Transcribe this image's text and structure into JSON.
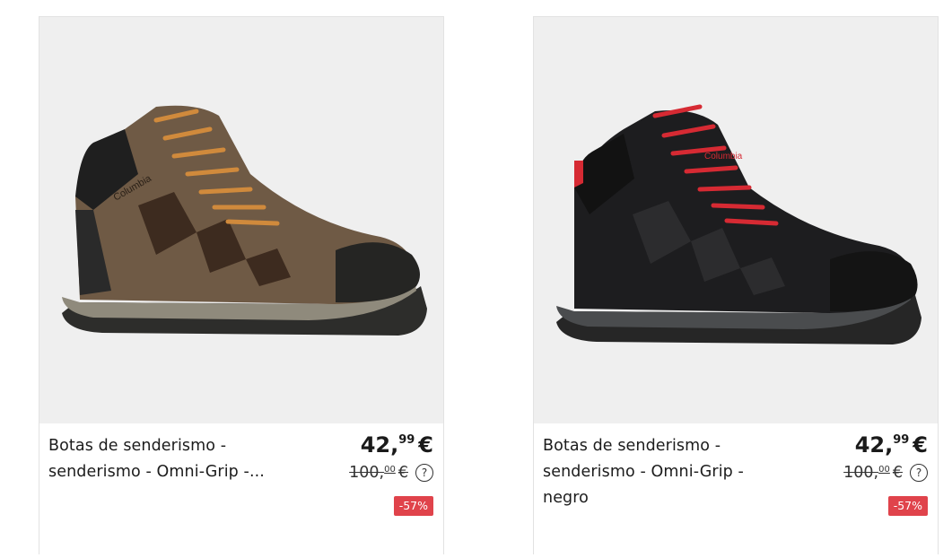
{
  "products": [
    {
      "title": "Botas de senderismo - senderismo - Omni-Grip -...",
      "price_int": "42,",
      "price_dec": "99",
      "currency": "€",
      "old_price_int": "100,",
      "old_price_dec": "00",
      "discount": "-57%",
      "help_glyph": "?",
      "image": {
        "icon": "hiking-boot-brown",
        "brand": "Columbia",
        "colors": {
          "upper": "#6f5a45",
          "lace": "#d08a3c",
          "sole": "#3a3a38"
        }
      }
    },
    {
      "title": "Botas de senderismo - senderismo - Omni-Grip - negro",
      "price_int": "42,",
      "price_dec": "99",
      "currency": "€",
      "old_price_int": "100,",
      "old_price_dec": "00",
      "discount": "-57%",
      "help_glyph": "?",
      "image": {
        "icon": "hiking-boot-black",
        "brand": "Columbia",
        "colors": {
          "upper": "#1d1d1f",
          "lace": "#d62a33",
          "sole": "#4a4c4e"
        }
      }
    }
  ]
}
